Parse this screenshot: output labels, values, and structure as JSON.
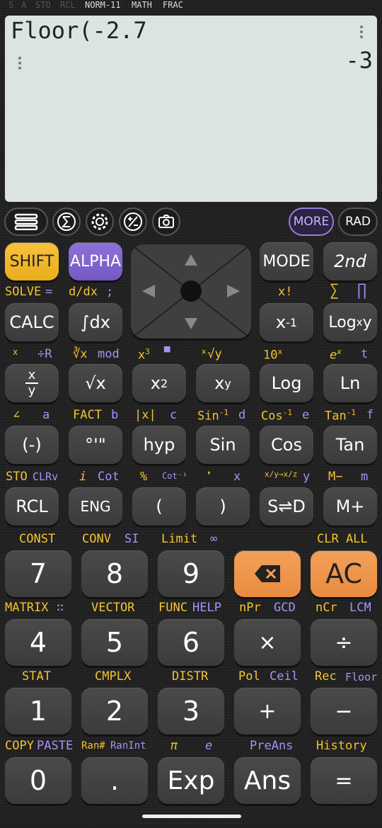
{
  "status": {
    "s": "S",
    "a": "A",
    "sto": "STO",
    "rcl": "RCL",
    "norm": "NORM-11",
    "math": "MATH",
    "frac": "FRAC"
  },
  "display": {
    "expression": "Floor(-2.7",
    "result": "-3"
  },
  "toolbar": {
    "more": "MORE",
    "rad": "RAD"
  },
  "keys": {
    "shift": "SHIFT",
    "alpha": "ALPHA",
    "mode": "MODE",
    "second": "2nd",
    "calc": "CALC",
    "integral": "∫dx",
    "x_inverse": "x",
    "inverse_sup": "-1",
    "logxy": "Log",
    "logxy_sub": "x",
    "logxy_y": "y",
    "frac_num": "x",
    "frac_den": "y",
    "sqrt": "√x",
    "x2": "x",
    "x2_sup": "2",
    "xy": "x",
    "xy_sup": "y",
    "log": "Log",
    "ln": "Ln",
    "neg": "(-)",
    "deg": "°'\"",
    "hyp": "hyp",
    "sin": "Sin",
    "cos": "Cos",
    "tan": "Tan",
    "rcl": "RCL",
    "eng": "ENG",
    "lparen": "(",
    "rparen": ")",
    "sd": "S⇌D",
    "mplus": "M+",
    "seven": "7",
    "eight": "8",
    "nine": "9",
    "ac": "AC",
    "four": "4",
    "five": "5",
    "six": "6",
    "times": "×",
    "divide": "÷",
    "one": "1",
    "two": "2",
    "three": "3",
    "plus": "+",
    "minus": "−",
    "zero": "0",
    "dot": ".",
    "exp": "Exp",
    "ans": "Ans",
    "equals": "="
  },
  "labels": {
    "solve": "SOLVE",
    "eq": "=",
    "ddx": "d/dx",
    "semi": ";",
    "xfact": "x!",
    "sigma": "∑",
    "pi_prod": "∏",
    "xyz": "x",
    "divR": "÷R",
    "cbrt": "∛x",
    "mod": "mod",
    "x3": "x",
    "x3_sup": "3",
    "bar": "▀",
    "rooty": "ˣ√y",
    "ten_x": "10",
    "ten_sup": "x",
    "ex": "e",
    "ex_sup": "x",
    "t": "t",
    "angle": "∠",
    "a": "a",
    "fact": "FACT",
    "b": "b",
    "abs": "|x|",
    "c": "c",
    "sin_inv": "Sin",
    "sin_inv_sup": "-1",
    "d": "d",
    "cos_inv": "Cos",
    "cos_inv_sup": "-1",
    "e_var": "e",
    "tan_inv": "Tan",
    "tan_inv_sup": "-1",
    "f": "f",
    "sto": "STO",
    "clrv": "CLRv",
    "i": "i",
    "cot": "Cot",
    "percent": "%",
    "cot_inv": "Cot⁻¹",
    "comma": "❜",
    "x_var": "x",
    "conv": "x/y→x/z",
    "y_var": "y",
    "mminus": "M−",
    "m": "m",
    "const": "CONST",
    "conv2": "CONV",
    "si": "SI",
    "limit": "Limit",
    "inf": "∞",
    "clr_all": "CLR ALL",
    "matrix": "MATRIX",
    "vector": "VECTOR",
    "func": "FUNC",
    "help": "HELP",
    "npr": "nPr",
    "gcd": "GCD",
    "ncr": "nCr",
    "lcm": "LCM",
    "stat": "STAT",
    "cmplx": "CMPLX",
    "distr": "DISTR",
    "pol": "Pol",
    "ceil": "Ceil",
    "rec": "Rec",
    "floor": "Floor",
    "copy": "COPY",
    "paste": "PASTE",
    "ranhash": "Ran#",
    "ranint": "RanInt",
    "pi": "π",
    "e_const": "e",
    "preans": "PreAns",
    "history": "History"
  }
}
